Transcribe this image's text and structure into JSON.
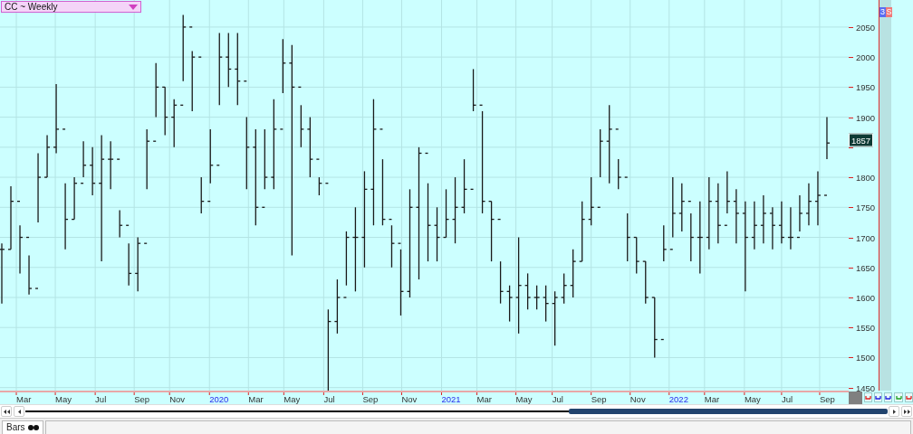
{
  "symbol_selector": {
    "label": "CC ~ Weekly"
  },
  "badges": [
    {
      "label": "3",
      "color": "#5a6cf0"
    },
    {
      "label": "S",
      "color": "#f07878"
    }
  ],
  "chart": {
    "last_price": {
      "label": "1857"
    },
    "price_axis_labels": [
      "2050",
      "2000",
      "1950",
      "1900",
      "1800",
      "1750",
      "1700",
      "1650",
      "1600",
      "1550",
      "1500",
      "1450"
    ],
    "time_axis_labels": [
      {
        "label": "Mar",
        "kind": "month"
      },
      {
        "label": "May",
        "kind": "month"
      },
      {
        "label": "Jul",
        "kind": "month"
      },
      {
        "label": "Sep",
        "kind": "month"
      },
      {
        "label": "Nov",
        "kind": "month"
      },
      {
        "label": "2020",
        "kind": "year"
      },
      {
        "label": "Mar",
        "kind": "month"
      },
      {
        "label": "May",
        "kind": "month"
      },
      {
        "label": "Jul",
        "kind": "month"
      },
      {
        "label": "Sep",
        "kind": "month"
      },
      {
        "label": "Nov",
        "kind": "month"
      },
      {
        "label": "2021",
        "kind": "year"
      },
      {
        "label": "Mar",
        "kind": "month"
      },
      {
        "label": "May",
        "kind": "month"
      },
      {
        "label": "Jul",
        "kind": "month"
      },
      {
        "label": "Sep",
        "kind": "month"
      },
      {
        "label": "Nov",
        "kind": "month"
      },
      {
        "label": "2022",
        "kind": "year"
      },
      {
        "label": "Mar",
        "kind": "month"
      },
      {
        "label": "May",
        "kind": "month"
      },
      {
        "label": "Jul",
        "kind": "month"
      },
      {
        "label": "Sep",
        "kind": "month"
      }
    ]
  },
  "status_bar": {
    "tabs": [
      {
        "label": "Bars"
      }
    ]
  }
}
